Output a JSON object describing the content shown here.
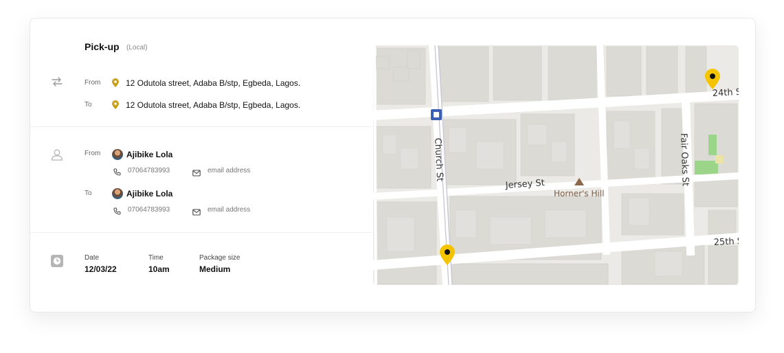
{
  "pickup": {
    "title": "Pick-up",
    "type": "(Local)",
    "from_label": "From",
    "to_label": "To",
    "from_address": "12 Odutola street, Adaba B/stp, Egbeda, Lagos.",
    "to_address": "12 Odutola street, Adaba B/stp, Egbeda, Lagos."
  },
  "contacts": {
    "from_label": "From",
    "to_label": "To",
    "from": {
      "name": "Ajibike Lola",
      "phone": "07064783993",
      "email": "email address"
    },
    "to": {
      "name": "Ajibike Lola",
      "phone": "07064783993",
      "email": "email address"
    }
  },
  "details": {
    "date_label": "Date",
    "date_value": "12/03/22",
    "time_label": "Time",
    "time_value": "10am",
    "size_label": "Package size",
    "size_value": "Medium"
  },
  "map": {
    "streets": {
      "church": "Church St",
      "jersey": "Jersey St",
      "fair_oaks": "Fair Oaks St",
      "s24": "24th St",
      "s25": "25th St"
    },
    "poi": "Horner's Hill",
    "pin_color": "#f5c400",
    "accent_pin_color": "#c8a11a"
  },
  "icons": {
    "swap": "swap-arrows-icon",
    "user": "user-icon",
    "clock": "clock-icon",
    "location": "location-pin-icon",
    "phone": "phone-icon",
    "mail": "mail-icon"
  }
}
